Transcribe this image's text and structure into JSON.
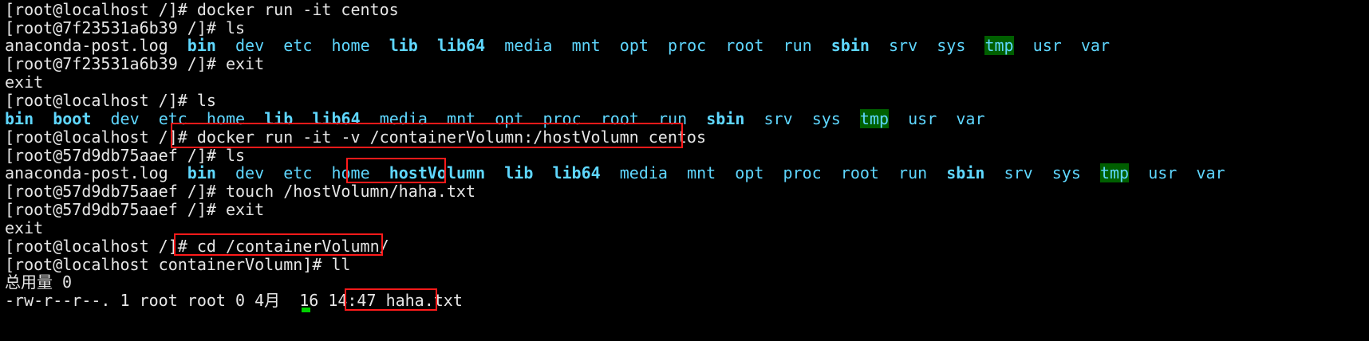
{
  "lines": [
    "[root@localhost /]# docker run -it centos",
    "[root@7f23531a6b39 /]# ls",
    null,
    "[root@7f23531a6b39 /]# exit",
    "exit",
    "[root@localhost /]# ls",
    null,
    null,
    "[root@57d9db75aaef /]# ls",
    null,
    "[root@57d9db75aaef /]# touch /hostVolumn/haha.txt",
    "[root@57d9db75aaef /]# exit",
    "exit",
    null,
    "[root@localhost containerVolumn]# ll",
    "总用量 0",
    null
  ],
  "ls1": {
    "first": "anaconda-post.log",
    "dirs": [
      "bin",
      "dev",
      "etc",
      "home",
      "lib",
      "lib64",
      "media",
      "mnt",
      "opt",
      "proc",
      "root",
      "run",
      "sbin",
      "srv",
      "sys",
      "tmp",
      "usr",
      "var"
    ]
  },
  "ls2": {
    "dirs": [
      "bin",
      "boot",
      "dev",
      "etc",
      "home",
      "lib",
      "lib64",
      "media",
      "mnt",
      "opt",
      "proc",
      "root",
      "run",
      "sbin",
      "srv",
      "sys",
      "tmp",
      "usr",
      "var"
    ]
  },
  "cmd_volume": {
    "prompt": "[root@localhost /]# ",
    "command": "docker run -it -v /containerVolumn:/hostVolumn centos"
  },
  "ls3": {
    "first": "anaconda-post.log",
    "highlight": "hostVolumn",
    "dirs": [
      "bin",
      "dev",
      "etc",
      "home",
      "hostVolumn",
      "lib",
      "lib64",
      "media",
      "mnt",
      "opt",
      "proc",
      "root",
      "run",
      "sbin",
      "srv",
      "sys",
      "tmp",
      "usr",
      "var"
    ]
  },
  "cmd_cd": {
    "prompt": "[root@localhost /]# ",
    "command": "cd /containerVolumn/"
  },
  "ll_entry": {
    "meta": "-rw-r--r--. 1 root root 0 4月  16 14:47 ",
    "filename": "haha.txt"
  },
  "colors": {
    "background": "#000000",
    "text": "#e6e6e6",
    "directory": "#5fd7ff",
    "tmp_bg": "#005f00",
    "annotation_box": "#ff1a1a",
    "cursor": "#00d000"
  }
}
